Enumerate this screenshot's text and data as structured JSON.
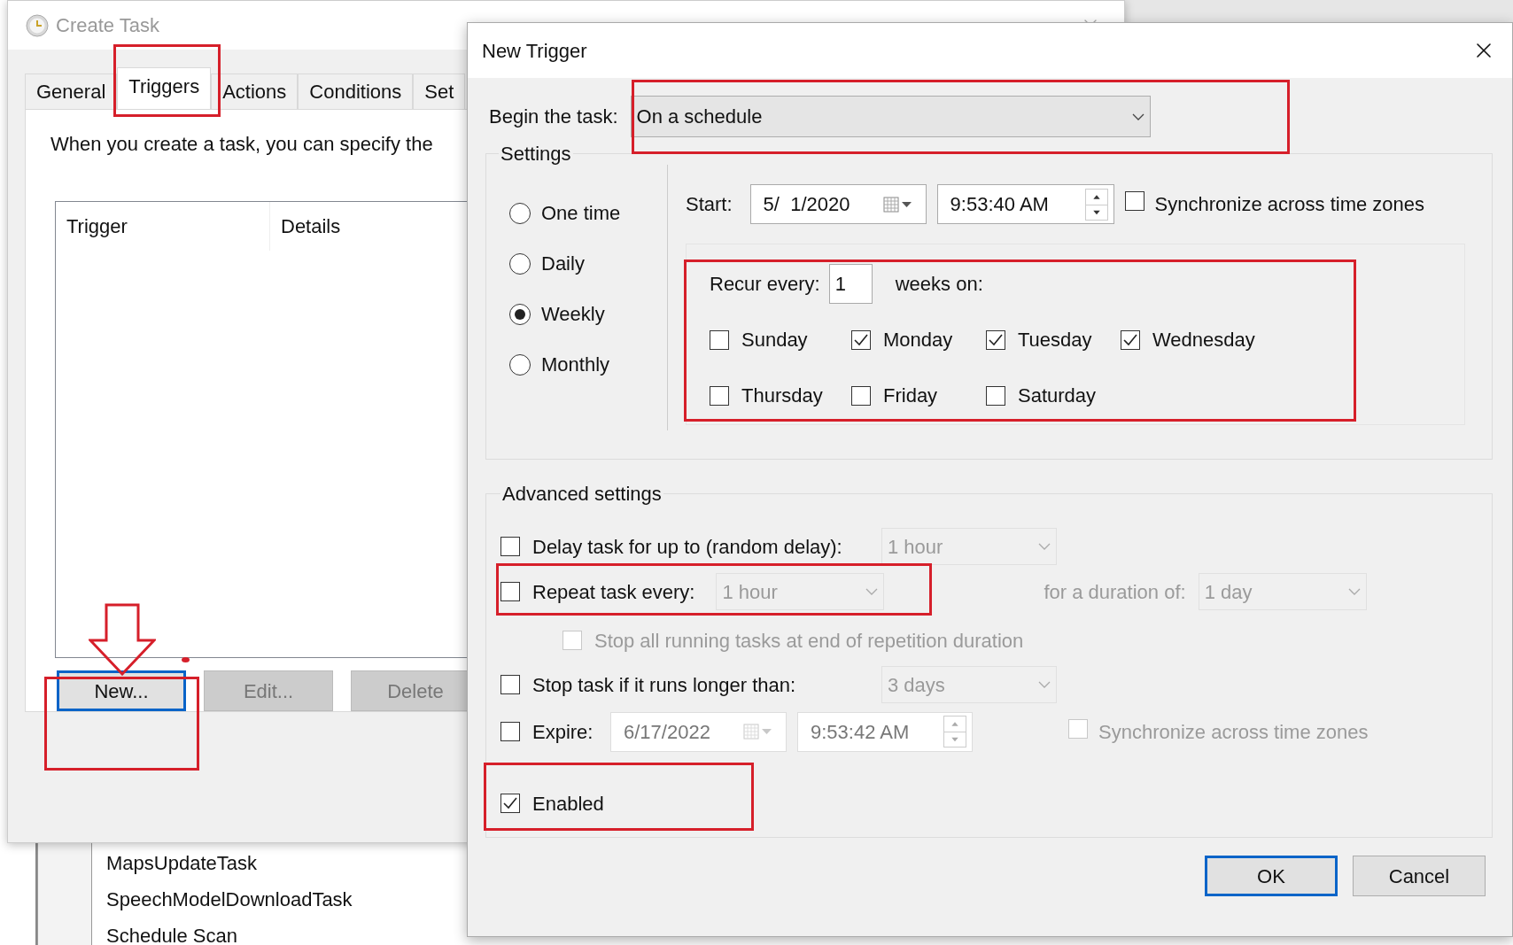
{
  "create_task": {
    "title": "Create Task",
    "tabs": [
      {
        "label": "General",
        "selected": false
      },
      {
        "label": "Triggers",
        "selected": true
      },
      {
        "label": "Actions",
        "selected": false
      },
      {
        "label": "Conditions",
        "selected": false
      },
      {
        "label": "Set",
        "selected": false
      }
    ],
    "description": "When you create a task, you can specify the",
    "table": {
      "columns": [
        "Trigger",
        "Details"
      ]
    },
    "buttons": [
      {
        "label": "New...",
        "disabled": false,
        "focused": true
      },
      {
        "label": "Edit...",
        "disabled": true,
        "focused": false
      },
      {
        "label": "Delete",
        "disabled": true,
        "focused": false
      }
    ]
  },
  "task_list": {
    "rows": [
      {
        "name": "MapsUpdateTask"
      },
      {
        "name": "SpeechModelDownloadTask"
      },
      {
        "name": "Schedule Scan"
      }
    ]
  },
  "new_trigger": {
    "title": "New Trigger",
    "begin_label": "Begin the task:",
    "begin_value": "On a schedule",
    "settings": {
      "title": "Settings",
      "schedule": [
        {
          "label": "One time",
          "selected": false
        },
        {
          "label": "Daily",
          "selected": false
        },
        {
          "label": "Weekly",
          "selected": true
        },
        {
          "label": "Monthly",
          "selected": false
        }
      ],
      "start_label": "Start:",
      "start_date": "5/  1/2020",
      "start_time": "9:53:40 AM",
      "sync": {
        "label": "Synchronize across time zones",
        "checked": false
      },
      "recur_label": "Recur every:",
      "recur_value": "1",
      "recur_unit": "weeks on:",
      "days": [
        {
          "label": "Sunday",
          "checked": false
        },
        {
          "label": "Monday",
          "checked": true
        },
        {
          "label": "Tuesday",
          "checked": true
        },
        {
          "label": "Wednesday",
          "checked": true
        },
        {
          "label": "Thursday",
          "checked": false
        },
        {
          "label": "Friday",
          "checked": false
        },
        {
          "label": "Saturday",
          "checked": false
        }
      ]
    },
    "advanced": {
      "title": "Advanced settings",
      "delay": {
        "label": "Delay task for up to (random delay):",
        "checked": false,
        "value": "1 hour"
      },
      "repeat": {
        "label": "Repeat task every:",
        "checked": false,
        "value": "1 hour",
        "duration_label": "for a duration of:",
        "duration_value": "1 day"
      },
      "stop_all": {
        "label": "Stop all running tasks at end of repetition duration",
        "checked": false,
        "disabled": true
      },
      "stop_long": {
        "label": "Stop task if it runs longer than:",
        "checked": false,
        "value": "3 days"
      },
      "expire": {
        "label": "Expire:",
        "checked": false,
        "date": "6/17/2022",
        "time": "9:53:42 AM"
      },
      "expire_sync": {
        "label": "Synchronize across time zones",
        "checked": false,
        "disabled": true
      },
      "enabled": {
        "label": "Enabled",
        "checked": true
      }
    },
    "buttons": [
      {
        "label": "OK",
        "focused": true
      },
      {
        "label": "Cancel",
        "focused": false
      }
    ]
  }
}
